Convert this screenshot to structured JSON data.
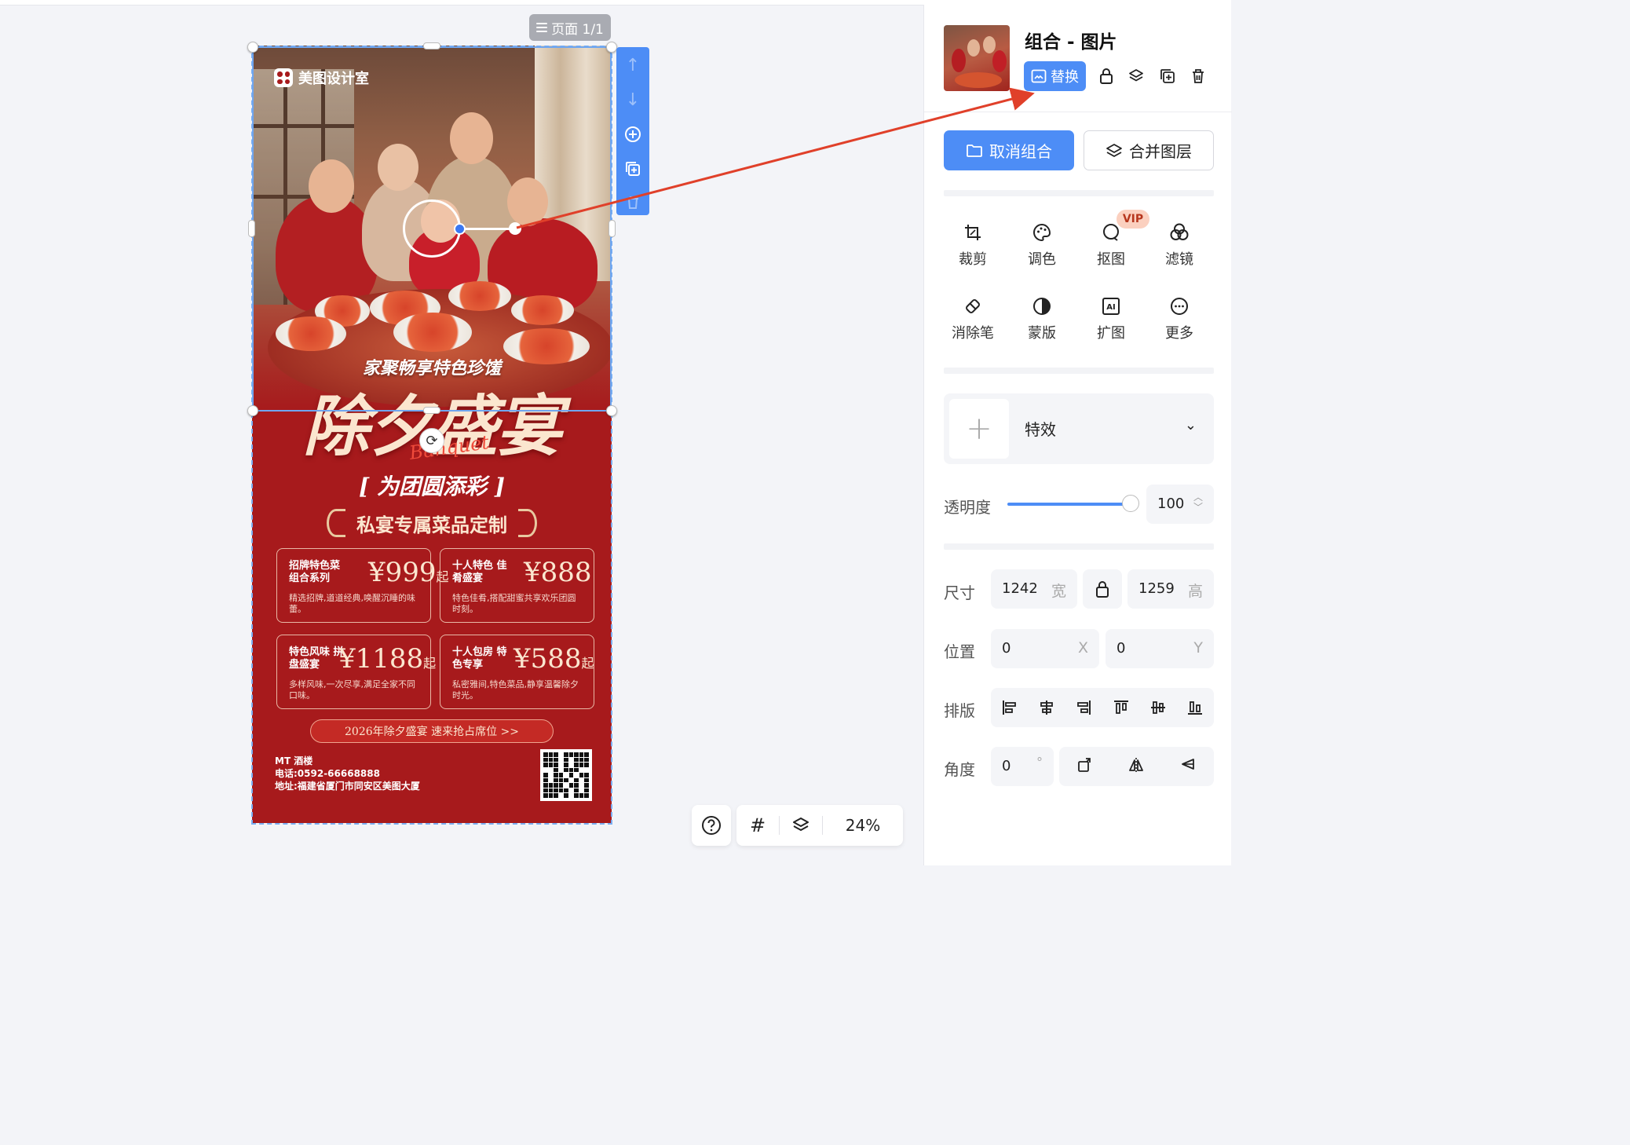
{
  "canvas": {
    "page_indicator": "页面 1/1",
    "zoom": "24%"
  },
  "poster": {
    "brand": "美图设计室",
    "subtitle": "家聚畅享特色珍馐",
    "title": "除夕盛宴",
    "script": "Banquet",
    "tagline": "[ 为团圆添彩 ]",
    "section": "私宴专属菜品定制",
    "cards": [
      {
        "name": "招牌特色菜 组合系列",
        "price": "¥999",
        "suffix": "起",
        "desc": "精选招牌,道道经典,唤醒沉睡的味蕾。"
      },
      {
        "name": "十人特色 佳肴盛宴",
        "price": "¥888",
        "suffix": "",
        "desc": "特色佳肴,搭配甜蜜共享欢乐团圆时刻。"
      },
      {
        "name": "特色风味 拼盘盛宴",
        "price": "¥1188",
        "suffix": "起",
        "desc": "多样风味,一次尽享,满足全家不同口味。"
      },
      {
        "name": "十人包房 特色专享",
        "price": "¥588",
        "suffix": "起",
        "desc": "私密雅间,特色菜品,静享温馨除夕时光。"
      }
    ],
    "cta": "2026年除夕盛宴   速来抢占席位 >>",
    "contact": {
      "name": "MT 酒楼",
      "phone": "电话:0592-66668888",
      "address": "地址:福建省厦门市同安区美图大厦"
    }
  },
  "panel": {
    "title": "组合 - 图片",
    "replace_label": "替换",
    "ungroup_label": "取消组合",
    "merge_label": "合并图层",
    "tools": [
      {
        "label": "裁剪",
        "icon": "crop-icon"
      },
      {
        "label": "调色",
        "icon": "palette-icon"
      },
      {
        "label": "抠图",
        "icon": "cutout-icon"
      },
      {
        "label": "滤镜",
        "icon": "filter-icon"
      },
      {
        "label": "消除笔",
        "icon": "eraser-icon"
      },
      {
        "label": "蒙版",
        "icon": "mask-icon"
      },
      {
        "label": "扩图",
        "icon": "ai-expand-icon"
      },
      {
        "label": "更多",
        "icon": "more-icon"
      }
    ],
    "vip_badge": "VIP",
    "effect_label": "特效",
    "opacity_label": "透明度",
    "opacity_value": "100",
    "opacity_level": 1.0,
    "size_label": "尺寸",
    "width": "1242",
    "width_unit": "宽",
    "height": "1259",
    "height_unit": "高",
    "position_label": "位置",
    "x": "0",
    "x_unit": "X",
    "y": "0",
    "y_unit": "Y",
    "layout_label": "排版",
    "angle_label": "角度",
    "angle": "0",
    "angle_unit": "°"
  },
  "colors": {
    "accent": "#4d8df6",
    "poster_red": "#a71a1c",
    "annotation_arrow": "#e0402a"
  }
}
